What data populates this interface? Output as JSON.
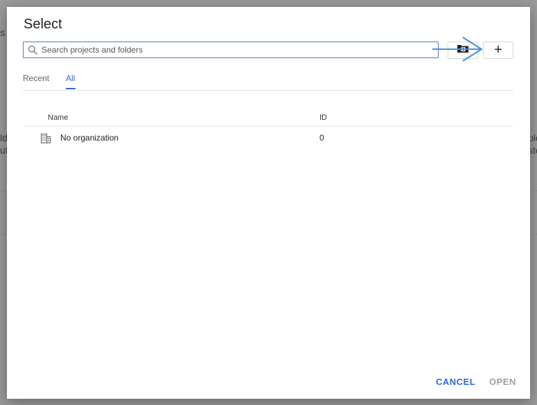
{
  "background": {
    "fragments": [
      "s",
      "ld",
      "ut",
      "ole",
      "sto"
    ]
  },
  "dialog": {
    "title": "Select",
    "search": {
      "placeholder": "Search projects and folders",
      "value": ""
    },
    "toolbar": {
      "new_folder_icon": "new-folder-icon",
      "add_label": "+"
    },
    "tabs": [
      {
        "label": "Recent",
        "active": false
      },
      {
        "label": "All",
        "active": true
      }
    ],
    "table": {
      "columns": [
        "Name",
        "ID"
      ],
      "rows": [
        {
          "icon": "organization-icon",
          "name": "No organization",
          "id": "0"
        }
      ]
    },
    "footer": {
      "cancel_label": "CANCEL",
      "open_label": "OPEN"
    }
  },
  "colors": {
    "accent": "#3367d6",
    "annotation_arrow": "#4a90e2",
    "disabled": "#9e9e9e"
  }
}
